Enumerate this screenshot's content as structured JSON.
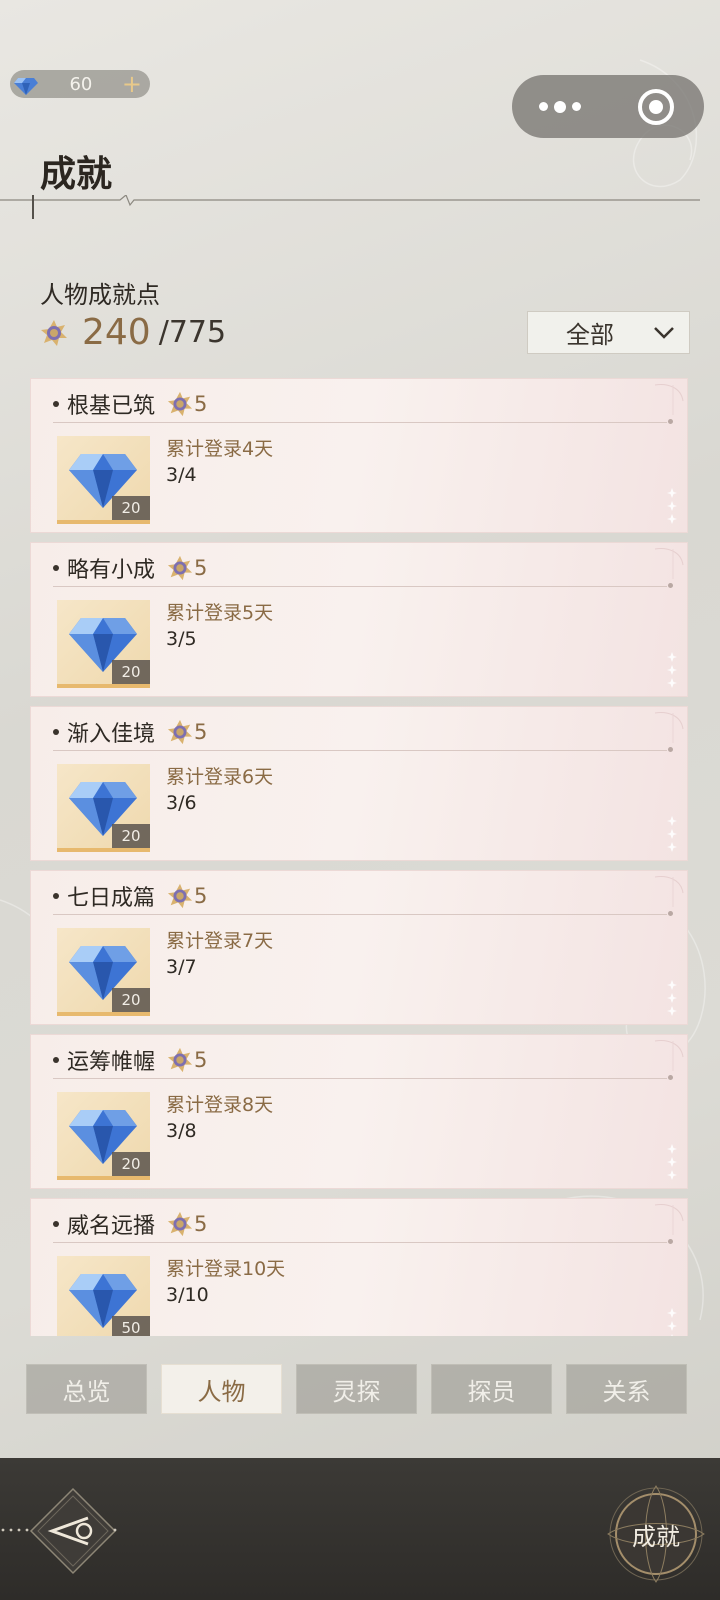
{
  "currency": {
    "icon": "diamond-icon",
    "amount": "60",
    "plus": "+"
  },
  "header": {
    "title": "成就"
  },
  "points": {
    "label": "人物成就点",
    "current": "240",
    "total": "/775",
    "icon": "medal-icon"
  },
  "filter": {
    "selected": "全部"
  },
  "achievements": [
    {
      "name": "根基已筑",
      "points": "5",
      "desc": "累计登录4天",
      "progress": "3/4",
      "reward_qty": "20"
    },
    {
      "name": "略有小成",
      "points": "5",
      "desc": "累计登录5天",
      "progress": "3/5",
      "reward_qty": "20"
    },
    {
      "name": "渐入佳境",
      "points": "5",
      "desc": "累计登录6天",
      "progress": "3/6",
      "reward_qty": "20"
    },
    {
      "name": "七日成篇",
      "points": "5",
      "desc": "累计登录7天",
      "progress": "3/7",
      "reward_qty": "20"
    },
    {
      "name": "运筹帷幄",
      "points": "5",
      "desc": "累计登录8天",
      "progress": "3/8",
      "reward_qty": "20"
    },
    {
      "name": "威名远播",
      "points": "5",
      "desc": "累计登录10天",
      "progress": "3/10",
      "reward_qty": "50"
    }
  ],
  "tabs": [
    {
      "label": "总览",
      "active": false
    },
    {
      "label": "人物",
      "active": true
    },
    {
      "label": "灵探",
      "active": false
    },
    {
      "label": "探员",
      "active": false
    },
    {
      "label": "关系",
      "active": false
    }
  ],
  "bottom": {
    "achievement_label": "成就"
  },
  "colors": {
    "accent": "#8a6b45",
    "bar": "#3c3a36"
  }
}
